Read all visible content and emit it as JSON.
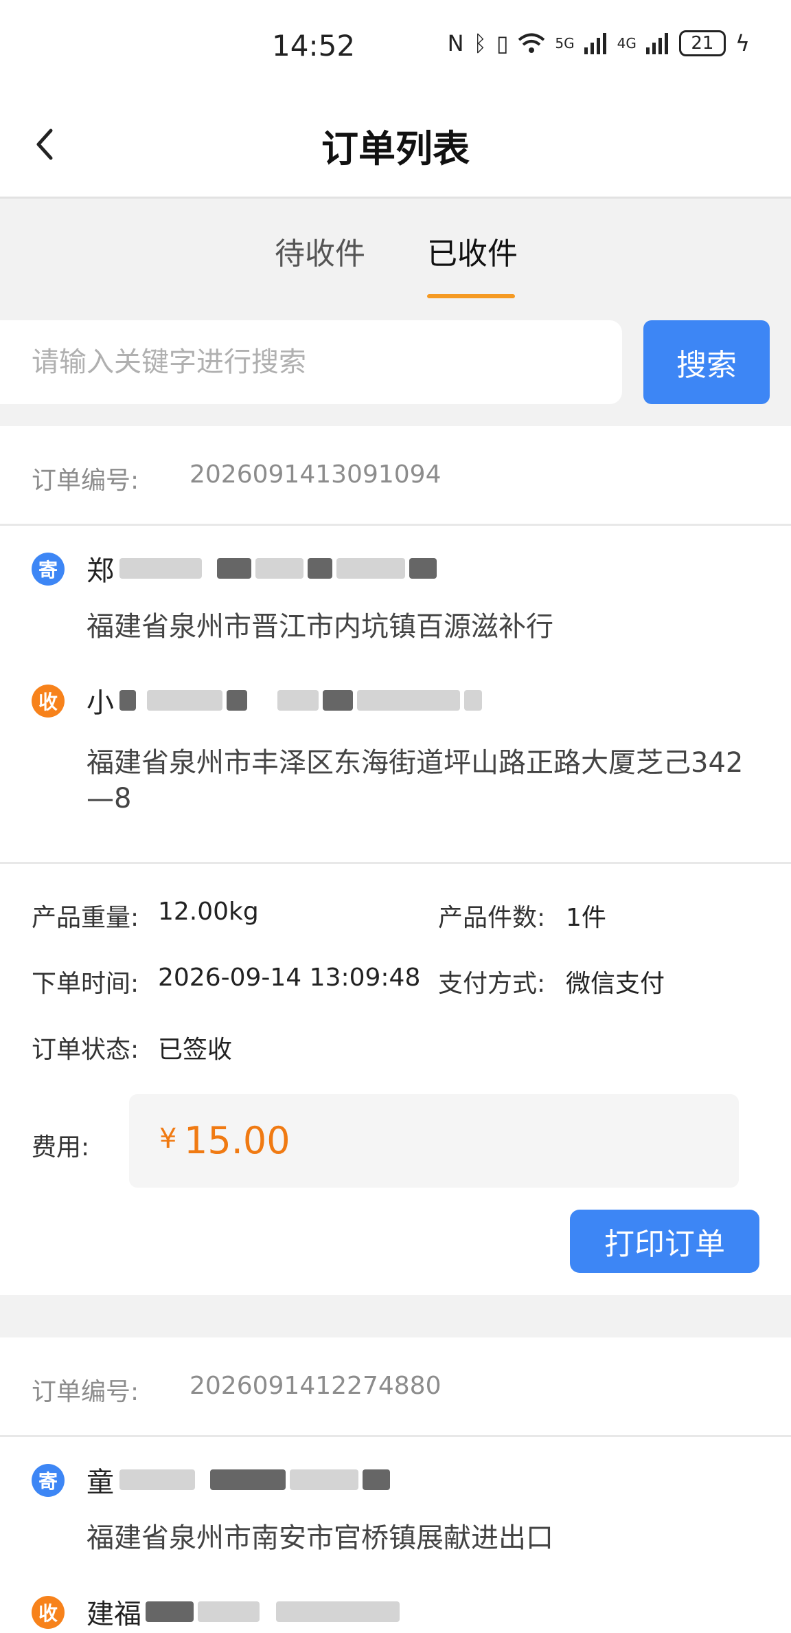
{
  "status_bar": {
    "time": "14:52",
    "network_5g": "5G",
    "network_4g": "4G",
    "battery": "21"
  },
  "header": {
    "title": "订单列表"
  },
  "tabs": [
    {
      "label": "待收件",
      "active": false
    },
    {
      "label": "已收件",
      "active": true
    }
  ],
  "search": {
    "placeholder": "请输入关键字进行搜索",
    "value": "",
    "button_label": "搜索"
  },
  "colors": {
    "accent": "#3d86f5",
    "tab_indicator": "#f59a23",
    "fee": "#f07a12",
    "badge_send": "#3d86f5",
    "badge_recv": "#f7821b"
  },
  "labels": {
    "order_no": "订单编号:",
    "weight": "产品重量:",
    "count": "产品件数:",
    "order_time": "下单时间:",
    "payment": "支付方式:",
    "status": "订单状态:",
    "fee": "费用:",
    "send_badge": "寄",
    "recv_badge": "收",
    "currency": "¥",
    "print_button": "打印订单"
  },
  "orders": [
    {
      "order_no": "2026091413091094",
      "sender_name_visible": "郑",
      "sender_address": "福建省泉州市晋江市内坑镇百源滋补行",
      "receiver_name_visible": "小",
      "receiver_address": "福建省泉州市丰泽区东海街道坪山路正路大厦芝己342—8",
      "weight": "12.00kg",
      "count": "1件",
      "order_time": "2026-09-14 13:09:48",
      "payment": "微信支付",
      "status": "已签收",
      "fee": "15.00"
    },
    {
      "order_no": "2026091412274880",
      "sender_name_visible": "童",
      "sender_address": "福建省泉州市南安市官桥镇展献进出口",
      "receiver_name_visible": "建福"
    }
  ]
}
